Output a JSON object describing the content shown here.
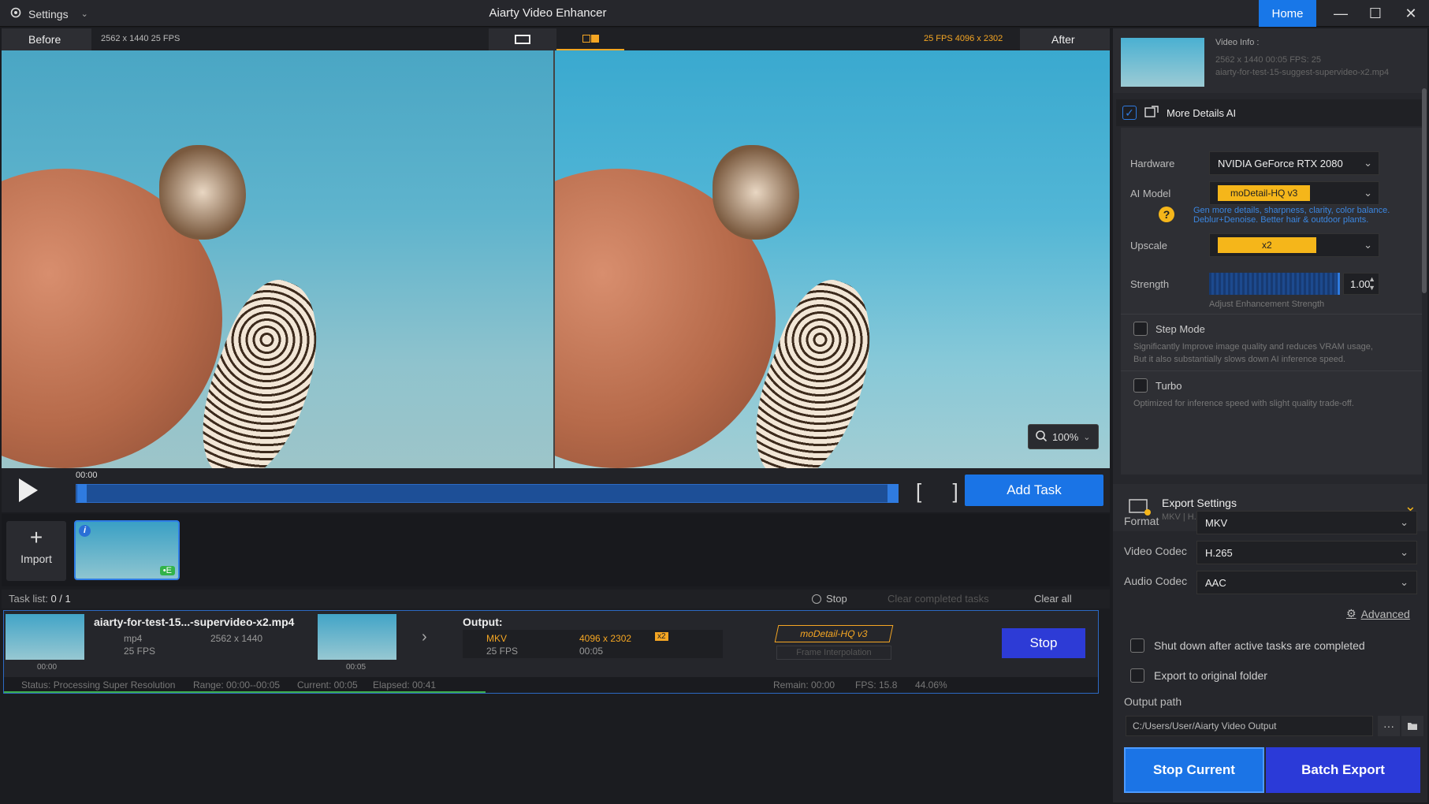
{
  "titlebar": {
    "settings_label": "Settings",
    "app_title": "Aiarty Video Enhancer",
    "home_label": "Home",
    "minimize": "—",
    "maximize": "☐",
    "close": "✕"
  },
  "preview": {
    "before_label": "Before",
    "before_meta": "2562 x 1440  25 FPS",
    "after_label": "After",
    "after_meta": "25 FPS  4096 x 2302",
    "zoom": "100%"
  },
  "timeline": {
    "time": "00:00",
    "brackets": "[ ]",
    "add_task_label": "Add Task"
  },
  "media": {
    "import_plus": "+",
    "import_label": "Import",
    "badge_e": "•E",
    "badge_i": "i"
  },
  "tasklist": {
    "label": "Task list:",
    "count": "0 / 1",
    "stop_label": "Stop",
    "clear_completed": "Clear completed tasks",
    "clear_all": "Clear all"
  },
  "task": {
    "name": "aiarty-for-test-15...-supervideo-x2.mp4",
    "format": "mp4",
    "fps": "25 FPS",
    "resolution": "2562 x 1440",
    "thumb_time_start": "00:00",
    "thumb_time_end": "00:05",
    "output_label": "Output:",
    "out_format": "MKV",
    "out_fps": "25 FPS",
    "out_resolution": "4096 x 2302",
    "out_scale": "x2",
    "out_duration": "00:05",
    "model_tag": "moDetail-HQ  v3",
    "frame_tag": "Frame Interpolation",
    "stop_label": "Stop",
    "status": "Status: Processing Super Resolution",
    "range": "Range: 00:00--00:05",
    "current": "Current: 00:05",
    "elapsed": "Elapsed: 00:41",
    "remain": "Remain: 00:00",
    "task_fps": "FPS: 15.8",
    "percent": "44.06%",
    "progress": 0.44
  },
  "video_info": {
    "title": "Video Info :",
    "meta": "2562 x 1440  00:05   FPS: 25",
    "filename": "aiarty-for-test-15-suggest-supervideo-x2.mp4"
  },
  "ai": {
    "section_title": "More Details AI",
    "hardware_label": "Hardware",
    "hardware_value": "NVIDIA GeForce RTX 2080",
    "model_label": "AI Model",
    "model_value": "moDetail-HQ  v3",
    "model_hint_1": "Gen more details, sharpness, clarity, color balance.",
    "model_hint_2": "Deblur+Denoise. Better hair & outdoor plants.",
    "upscale_label": "Upscale",
    "upscale_value": "x2",
    "strength_label": "Strength",
    "strength_value": "1.00",
    "strength_hint": "Adjust Enhancement Strength",
    "step_mode_label": "Step Mode",
    "step_mode_desc_1": "Significantly Improve image quality and reduces VRAM usage,",
    "step_mode_desc_2": "But it also substantially slows down AI inference speed.",
    "turbo_label": "Turbo",
    "turbo_desc": "Optimized for inference speed with slight quality trade-off."
  },
  "export": {
    "title": "Export Settings",
    "subtitle": "MKV | H.265, AAC |",
    "format_label": "Format",
    "format_value": "MKV",
    "vcodec_label": "Video Codec",
    "vcodec_value": "H.265",
    "acodec_label": "Audio Codec",
    "acodec_value": "AAC",
    "advanced_label": "Advanced",
    "shutdown_label": "Shut down after active tasks are completed",
    "original_folder_label": "Export to original folder",
    "output_path_label": "Output path",
    "output_path_value": "C:/Users/User/Aiarty Video Output",
    "more_btn": "···",
    "stop_current_label": "Stop Current",
    "batch_export_label": "Batch Export"
  },
  "colors": {
    "accent_blue": "#1a74e6",
    "accent_orange": "#f5a623",
    "stop_blue": "#2d3bd6"
  }
}
